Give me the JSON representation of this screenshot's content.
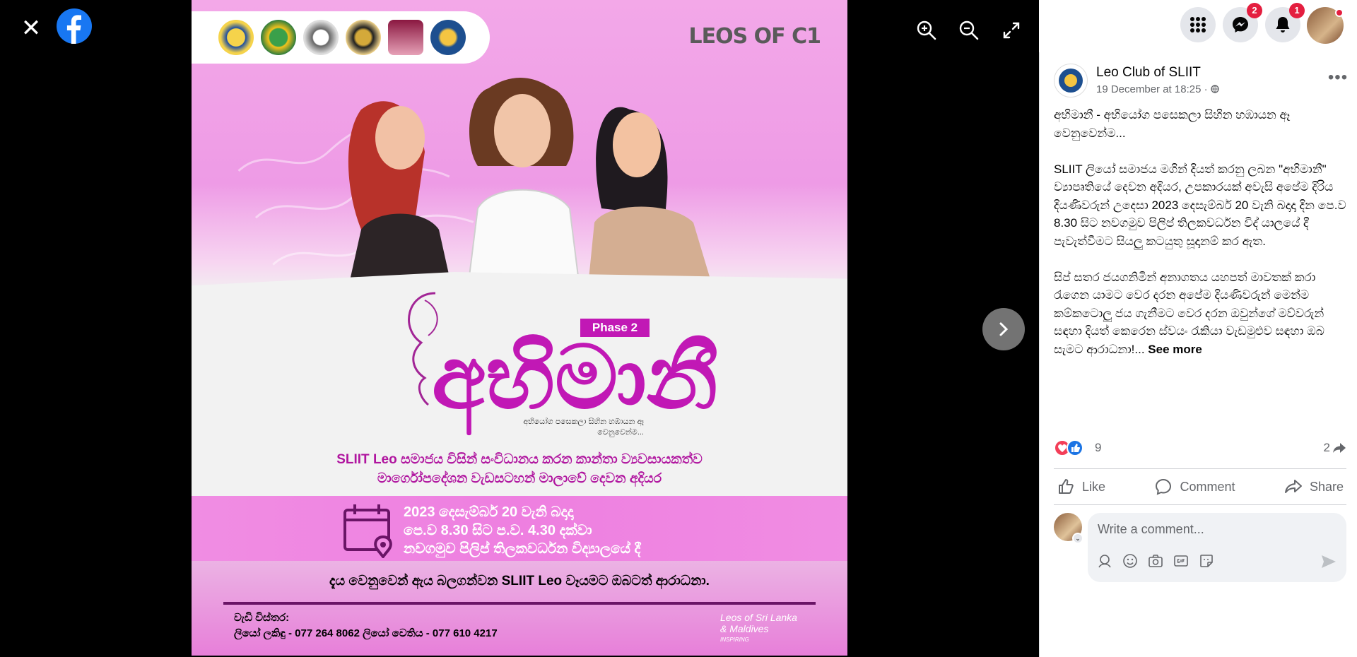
{
  "viewer": {
    "icons": [
      "close-icon",
      "facebook-logo",
      "zoom-in-icon",
      "zoom-out-icon",
      "fullscreen-icon",
      "chevron-right-icon"
    ]
  },
  "poster": {
    "brand": "LEOS OF C1",
    "phase": "Phase 2",
    "title": "අභිමානී",
    "tagline_line1": "අභියෝග පසෙකලා සිහින හඹායන ඈ",
    "tagline_line2": "වෙනුවෙන්ම...",
    "subtitle_line1": "SLIIT Leo සමාජය විසින් සංවිධානය කරන කාන්තා ව්‍යවසායකත්ව",
    "subtitle_line2": "මාර්ගෝපදේශන වැඩසටහන් මාලාවේ දෙවන අදියර",
    "info_line1": "2023 දෙසැම්බර් 20 වැනි බදාදා",
    "info_line2": "පෙ.ව 8.30 සිට ප.ව. 4.30 දක්වා",
    "info_line3": "නවගමුව පිලිප් තිලකවර්ධන විද්‍යාලයේ දී",
    "invite": "දැය වෙනුවෙන් ඇය බලගන්වන SLIIT Leo වෑයමට ඔබටත් ආරාධනා.",
    "contact_heading": "වැඩි විස්තර:",
    "contact_line": "ලියෝ ලකිඳු - 077 264 8062 ලියෝ වෙතිය - 077 610 4217",
    "district_logo_line1": "Leos of Sri Lanka",
    "district_logo_line2": "& Maldives",
    "district_logo_line3": "INSPIRING"
  },
  "topnav": {
    "messenger_badge": "2",
    "notifications_badge": "1"
  },
  "post": {
    "page_name": "Leo Club of SLIIT",
    "date": "19 December at 18:25",
    "separator": "·",
    "text": "අභිමානී - අභියෝග පසෙකලා සිහින හඹායන ඈ වෙනුවෙන්ම...\n\nSLIIT ලියෝ සමාජය මගින් දියත් කරනු ලබන \"අභිමානී\" ව්‍යාපෘතියේ දෙවන අදියර, උපකාරයක් අවැසි අපේම දිරිය දියණිවරුන් උදෙසා 2023 දෙසැම්බර් 20 වැනි බදාදා දින පෙ.ව 8.30 සිට නවගමුව පිලිප් තිලකවර්ධන විද් යාලයේ දී පැවැත්වීමට සියලු කටයුතු සූදානම් කර ඇත.\n\nසිප් සතර ජයගනිමින් අනාගතය යහපත් මාවතක් කරා රැගෙන යාමට වෙර දරන අපේම දියණිවරුන් මෙන්ම කම්කටොලු ජය ගැනීමට වෙර දරන ඔවුන්ගේ මව්වරුන් සඳහා දියත් කෙරෙන ස්වයං රැකියා වැඩමුළුව සඳහා ඔබ සැමට ආරාධනා!...",
    "see_more": "See more",
    "reaction_count": "9",
    "share_count": "2",
    "like_label": "Like",
    "comment_label": "Comment",
    "share_label": "Share",
    "comment_placeholder": "Write a comment..."
  },
  "colors": {
    "facebook_blue": "#1877f2",
    "badge_red": "#e41e3f",
    "poster_magenta": "#c118b5",
    "like_blue": "#1b74e4",
    "love_red": "#f33e58"
  }
}
